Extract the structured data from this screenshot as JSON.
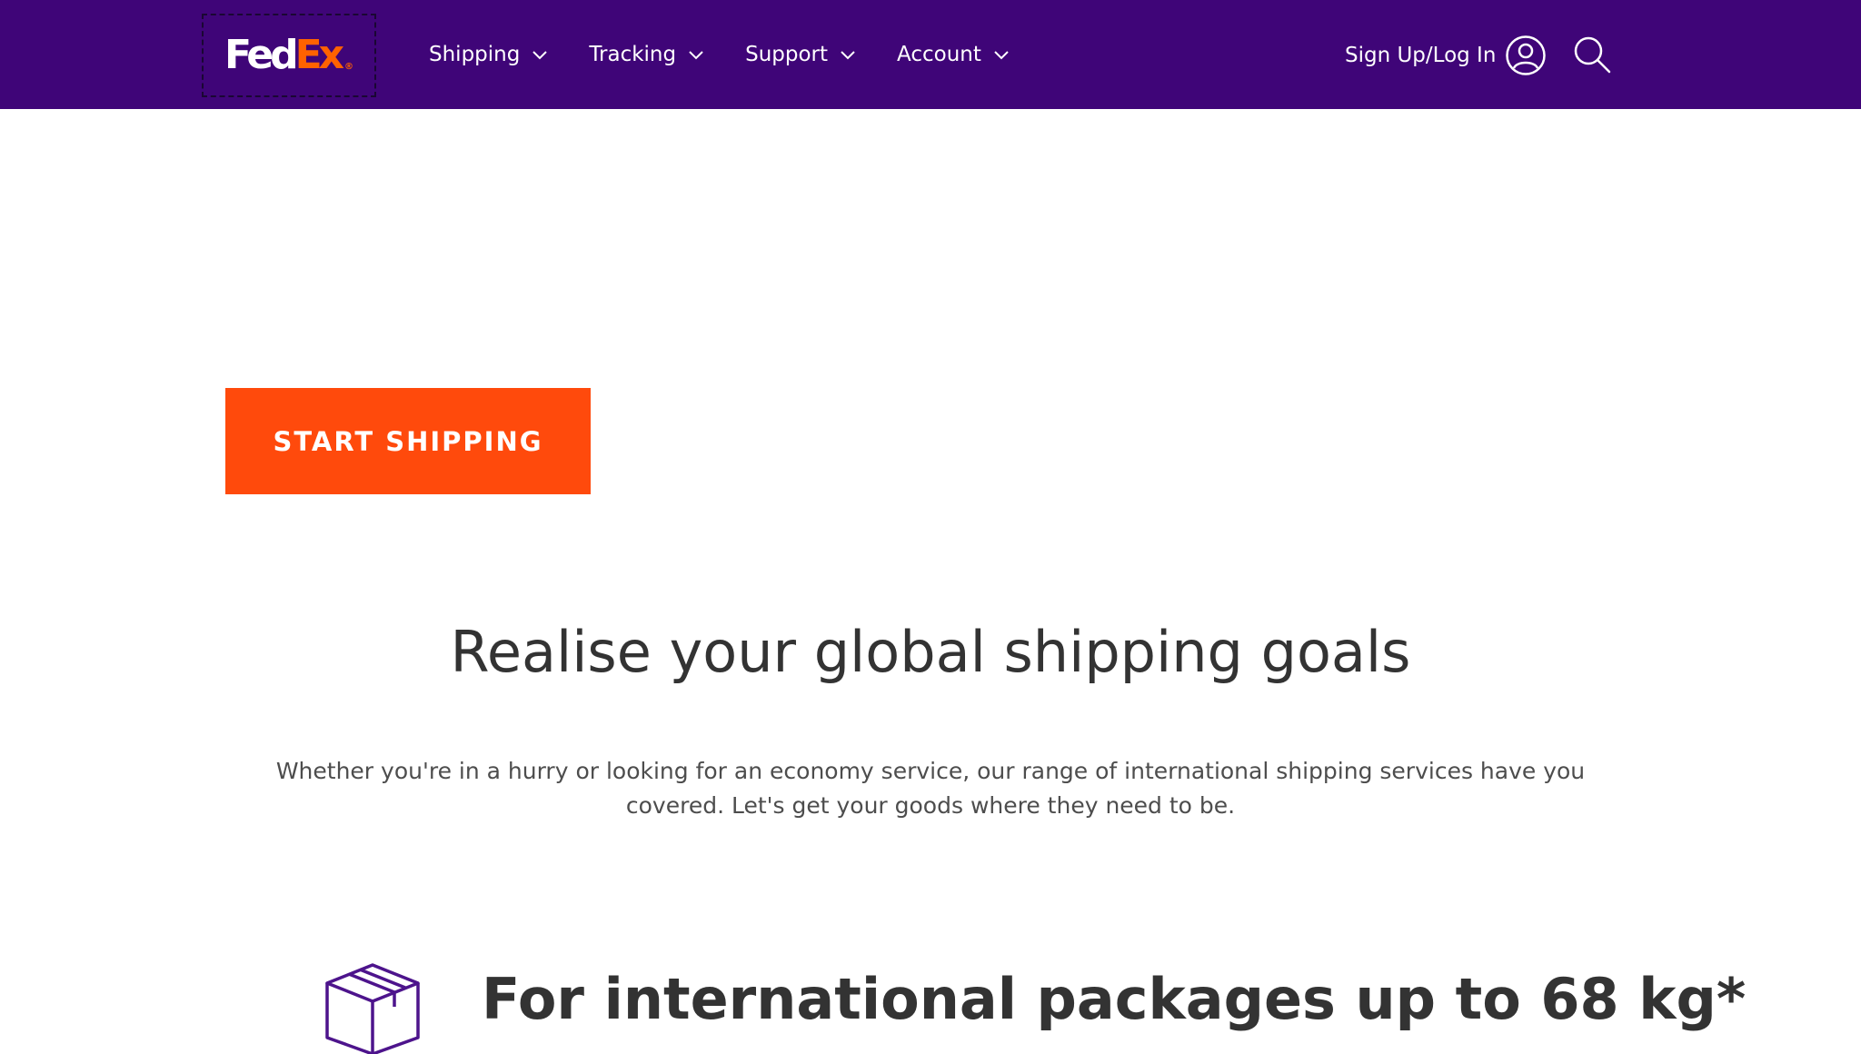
{
  "header": {
    "logo": {
      "fed": "Fed",
      "ex": "Ex",
      "mark": "®"
    },
    "nav": [
      {
        "label": "Shipping"
      },
      {
        "label": "Tracking"
      },
      {
        "label": "Support"
      },
      {
        "label": "Account"
      }
    ],
    "signin_label": "Sign Up/Log In",
    "icons": {
      "user": "user-circle-icon",
      "search": "search-icon",
      "chevron": "chevron-down-icon"
    }
  },
  "hero": {
    "cta_label": "START SHIPPING",
    "title": "Realise your global shipping goals",
    "description": "Whether you're in a hurry or looking for an economy service, our range of international shipping services have you covered. Let's get your goods where they need to be."
  },
  "feature": {
    "title": "For international packages up to 68 kg*",
    "icon": "package-box-icon"
  },
  "colors": {
    "header_bg": "#3f0578",
    "brand_orange": "#ff6200",
    "cta_bg": "#ff4a0c",
    "icon_purple": "#4d148c"
  }
}
